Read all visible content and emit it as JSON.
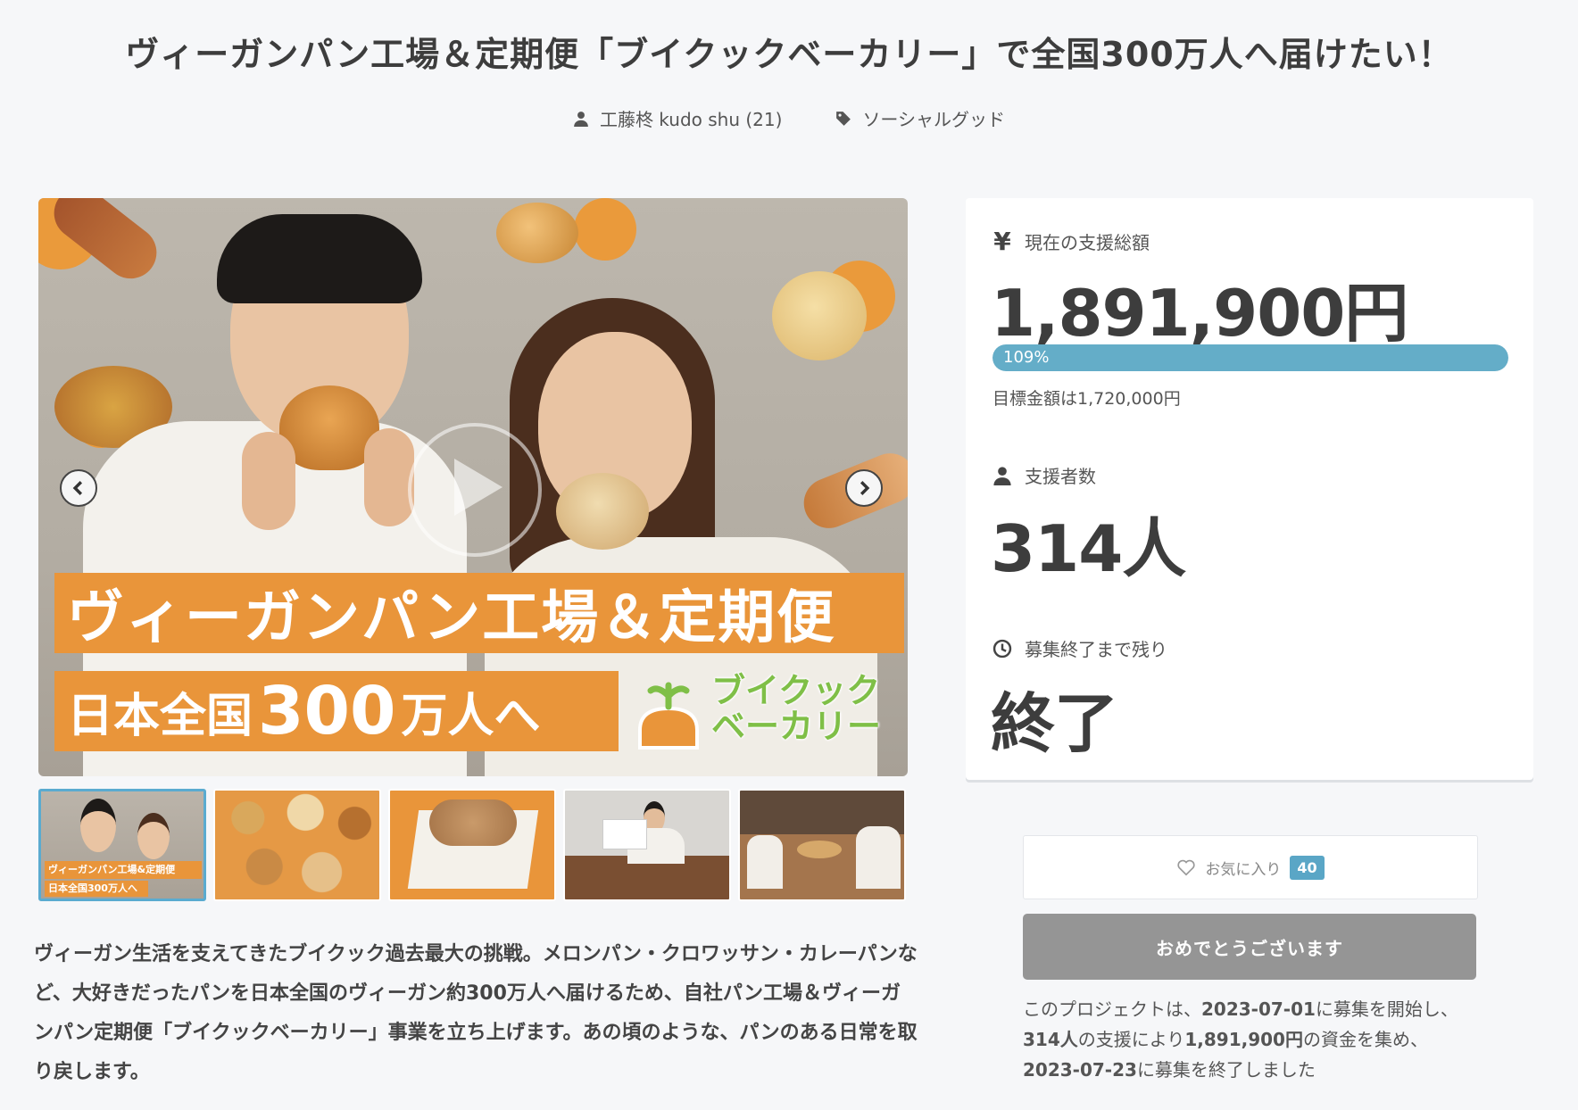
{
  "header": {
    "title": "ヴィーガンパン工場＆定期便「ブイクックベーカリー」で全国300万人へ届けたい！",
    "author": "工藤柊 kudo shu (21)",
    "category": "ソーシャルグッド"
  },
  "hero": {
    "banner_line1": "ヴィーガンパン工場＆定期便",
    "banner_line2_pre": "日本全国",
    "banner_line2_num": "300",
    "banner_line2_post": "万人へ",
    "logo_line1": "ブイクック",
    "logo_line2": "ベーカリー",
    "icons": {
      "play": "play-icon",
      "prev": "chevron-left-icon",
      "next": "chevron-right-icon"
    }
  },
  "thumbnails": [
    {
      "caption_line1": "ヴィーガンパン工場&定期便",
      "caption_line2": "日本全国300万人へ",
      "active": true
    },
    {
      "active": false
    },
    {
      "active": false
    },
    {
      "active": false
    },
    {
      "active": false
    }
  ],
  "description": "ヴィーガン生活を支えてきたブイクック過去最大の挑戦。メロンパン・クロワッサン・カレーパンなど、大好きだったパンを日本全国のヴィーガン約300万人へ届けるため、自社パン工場＆ヴィーガンパン定期便「ブイクックベーカリー」事業を立ち上げます。あの頃のような、パンのある日常を取り戻します。",
  "stats": {
    "total_label": "現在の支援総額",
    "total_value": "1,891,900円",
    "progress_percent": 109,
    "progress_label": "109%",
    "goal_text": "目標金額は1,720,000円",
    "backers_label": "支援者数",
    "backers_value": "314人",
    "remaining_label": "募集終了まで残り",
    "remaining_value": "終了",
    "icons": {
      "total": "yen-icon",
      "backers": "user-icon",
      "remaining": "clock-icon"
    }
  },
  "actions": {
    "favorite_label": "お気に入り",
    "favorite_count": "40",
    "congrats_label": "おめでとうございます"
  },
  "summary": {
    "p1": "このプロジェクトは、",
    "start_date": "2023-07-01",
    "p2": "に募集を開始し、",
    "backers": "314人",
    "p3": "の支援により",
    "amount": "1,891,900円",
    "p4": "の資金を集め、",
    "end_date": "2023-07-23",
    "p5": "に募集を終了しました"
  },
  "colors": {
    "accent_blue": "#64adc8",
    "orange": "#e9953a",
    "logo_green": "#7fbf47",
    "button_gray": "#959595"
  }
}
